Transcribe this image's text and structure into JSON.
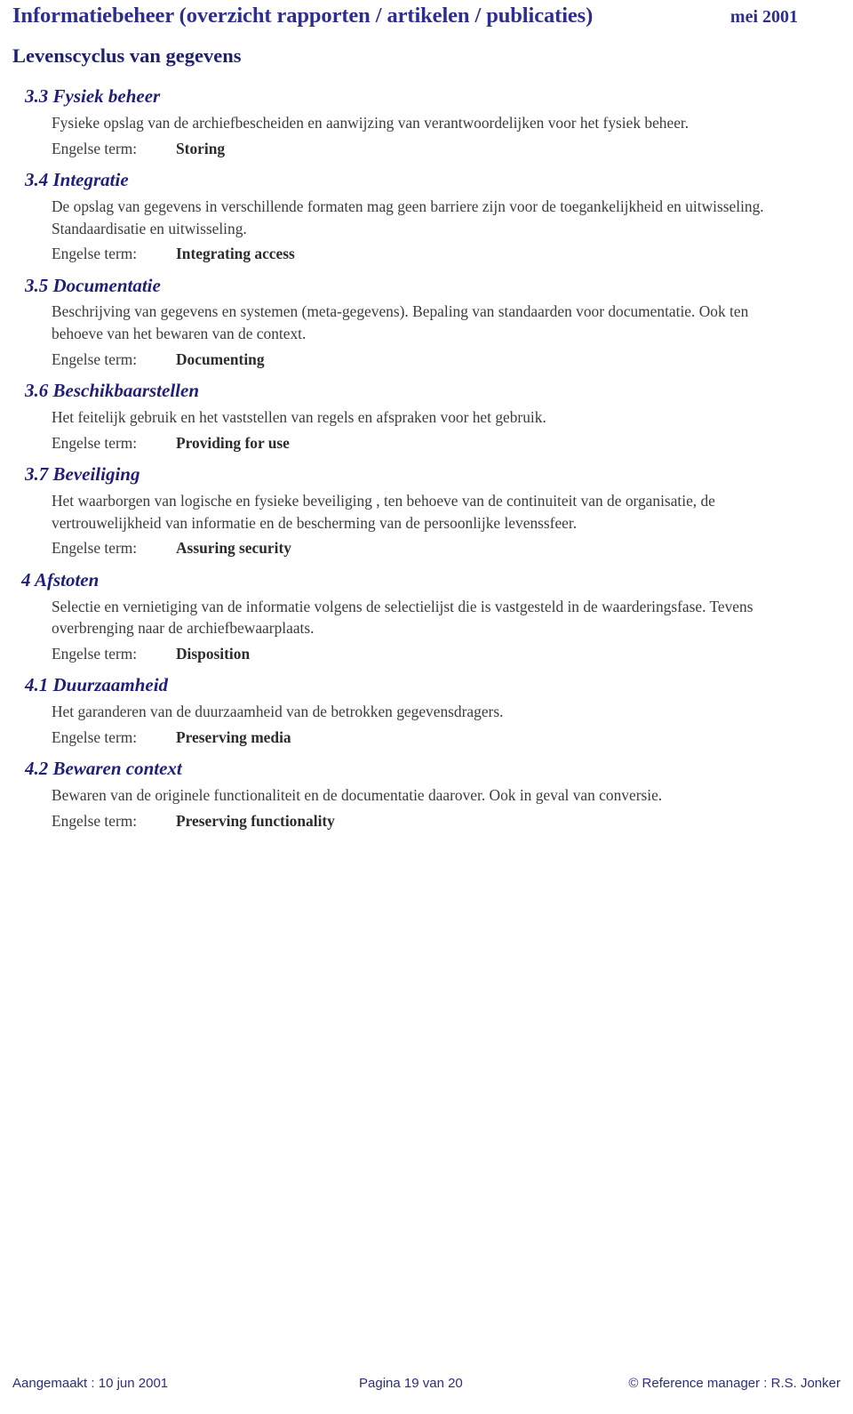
{
  "header": {
    "title": "Informatiebeheer (overzicht  rapporten / artikelen / publicaties)",
    "date": "mei 2001",
    "subtitle": "Levenscyclus van gegevens",
    "color": "#2e2e8f"
  },
  "term_label": "Engelse term:",
  "sections": [
    {
      "heading": "3.3 Fysiek beheer",
      "description": "Fysieke opslag van de archiefbescheiden en aanwijzing van verantwoordelijken voor het fysiek beheer.",
      "term_label": "Engelse term:",
      "term_value": "Storing"
    },
    {
      "heading": "3.4 Integratie",
      "description": "De opslag van gegevens in verschillende formaten mag geen barriere zijn voor de toegankelijkheid en uitwisseling. Standaardisatie en uitwisseling.",
      "term_label": "Engelse term:",
      "term_value": "Integrating access"
    },
    {
      "heading": "3.5 Documentatie",
      "description": "Beschrijving van gegevens en systemen (meta-gegevens). Bepaling van standaarden voor documentatie. Ook ten behoeve van het bewaren van de context.",
      "term_label": "Engelse term:",
      "term_value": "Documenting"
    },
    {
      "heading": "3.6 Beschikbaarstellen",
      "description": "Het feitelijk gebruik en het vaststellen van regels en afspraken voor het gebruik.",
      "term_label": "Engelse term:",
      "term_value": "Providing for use"
    },
    {
      "heading": "3.7 Beveiliging",
      "description": "Het waarborgen van logische en fysieke beveiliging , ten behoeve van de continuiteit van de organisatie, de vertrouwelijkheid van informatie en de bescherming van de persoonlijke levenssfeer.",
      "term_label": "Engelse term:",
      "term_value": "Assuring security"
    },
    {
      "heading": "4 Afstoten",
      "description": "Selectie en vernietiging van de informatie volgens de selectielijst die is vastgesteld in de waarderingsfase. Tevens overbrenging naar de archiefbewaarplaats.",
      "term_label": "Engelse term:",
      "term_value": "Disposition"
    },
    {
      "heading": "4.1 Duurzaamheid",
      "description": "Het garanderen van de duurzaamheid van de betrokken gegevensdragers.",
      "term_label": "Engelse term:",
      "term_value": "Preserving media"
    },
    {
      "heading": "4.2 Bewaren context",
      "description": "Bewaren van de originele functionaliteit en de documentatie daarover. Ook in geval van conversie.",
      "term_label": "Engelse term:",
      "term_value": "Preserving functionality"
    }
  ],
  "footer": {
    "created": "Aangemaakt : 10 jun 2001",
    "page": "Pagina 19 van  20",
    "copyright": "© Reference manager : R.S. Jonker"
  }
}
